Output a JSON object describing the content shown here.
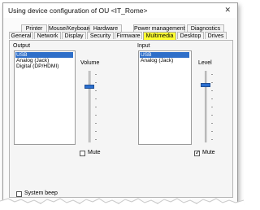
{
  "dialog": {
    "title": "Using device configuration of OU <IT_Rome>",
    "close_glyph": "✕"
  },
  "tabs": {
    "row_back": [
      "Printer",
      "Mouse/Keyboard",
      "Hardware",
      "Power management",
      "Diagnostics"
    ],
    "row_front": [
      "General",
      "Network",
      "Display",
      "Security",
      "Firmware",
      "Multimedia",
      "Desktop",
      "Drives"
    ],
    "active": "Multimedia",
    "active_color": "#ffff33"
  },
  "output": {
    "group_label": "Output",
    "items": [
      "USB",
      "Analog (Jack)",
      "Digital (DP/HDMI)"
    ],
    "selected": "USB",
    "slider_label": "Volume",
    "mute_label": "Mute",
    "mute_checked": false
  },
  "input": {
    "group_label": "Input",
    "items": [
      "USB",
      "Analog (Jack)"
    ],
    "selected": "USB",
    "slider_label": "Level",
    "mute_label": "Mute",
    "mute_checked": true
  },
  "system_beep": {
    "label": "System beep",
    "checked": false
  },
  "colors": {
    "selection": "#2f6fc9",
    "slider_thumb": "#2a6fd0"
  }
}
